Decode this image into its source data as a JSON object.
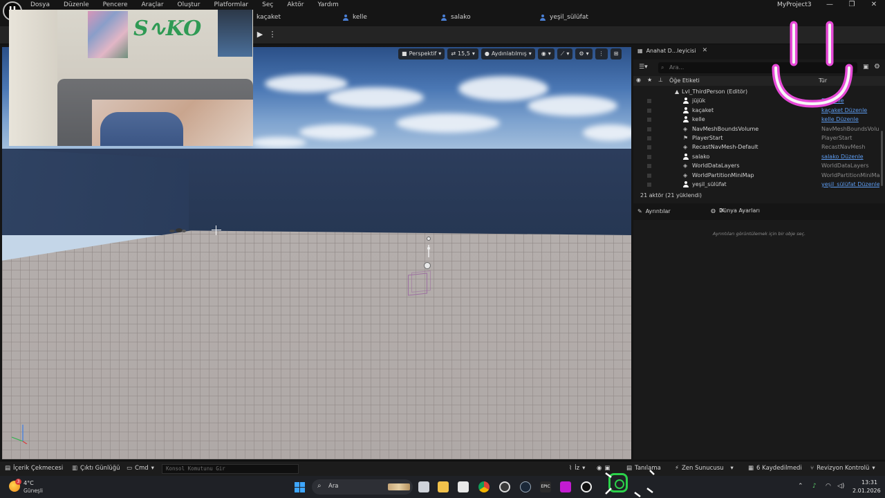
{
  "app": {
    "logo_letter": "U",
    "menu": [
      "Dosya",
      "Düzenle",
      "Pencere",
      "Araçlar",
      "Oluştur",
      "Platformlar",
      "Seç",
      "Aktör",
      "Yardım"
    ],
    "project_name": "MyProject3",
    "window_controls": [
      "—",
      "❐",
      "✕"
    ]
  },
  "level_tabs": [
    "kaçaket",
    "kelle",
    "salako",
    "yeşil_sülüfat"
  ],
  "viewport": {
    "view_mode": "Perspektif",
    "fov_value": "15,5",
    "lit_mode": "Aydınlatılmış"
  },
  "outliner": {
    "tab_title": "Anahat D...leyicisi",
    "search_placeholder": "Ara...",
    "col_label": "Öğe Etiketi",
    "col_type": "Tür",
    "level_row": "Lvl_ThirdPerson (Editör)",
    "rows": [
      {
        "label": "jüjük",
        "type": "Düzenle",
        "link": true
      },
      {
        "label": "kaçaket",
        "type": "kaçaket Düzenle",
        "link": true
      },
      {
        "label": "kelle",
        "type": "kelle Düzenle",
        "link": true
      },
      {
        "label": "NavMeshBoundsVolume",
        "type": "NavMeshBoundsVolu",
        "link": false
      },
      {
        "label": "PlayerStart",
        "type": "PlayerStart",
        "link": false
      },
      {
        "label": "RecastNavMesh-Default",
        "type": "RecastNavMesh",
        "link": false
      },
      {
        "label": "salako",
        "type": "salako Düzenle",
        "link": true
      },
      {
        "label": "WorldDataLayers",
        "type": "WorldDataLayers",
        "link": false
      },
      {
        "label": "WorldPartitionMiniMap",
        "type": "WorldPartitionMiniMa",
        "link": false
      },
      {
        "label": "yeşil_sülüfat",
        "type": "yeşil_sülüfat Düzenle",
        "link": true
      }
    ],
    "footer": "21 aktör (21 yüklendi)"
  },
  "details": {
    "tab_details": "Ayrıntılar",
    "tab_world": "Dünya Ayarları",
    "hint": "Ayrıntıları görüntülemek için bir obje seç."
  },
  "statusbar": {
    "content_drawer": "İçerik Çekmecesi",
    "output_log": "Çıktı Günlüğü",
    "cmd": "Cmd",
    "cmd_placeholder": "Konsol Komutunu Gir",
    "trace": "İz",
    "diagnostics": "Tanılama",
    "zen_server": "Zen Sunucusu",
    "unsaved": "6 Kaydedilmedi",
    "revision": "Revizyon Kontrolü"
  },
  "taskbar": {
    "weather_badge": "3",
    "weather_temp": "4°C",
    "weather_desc": "Güneşli",
    "search_label": "Ara",
    "time": "13:31",
    "date": "2.01.2026"
  },
  "colors": {
    "accent_link": "#5d9cf0",
    "smile": "#e64ad7",
    "insta": "#2bd14a"
  }
}
